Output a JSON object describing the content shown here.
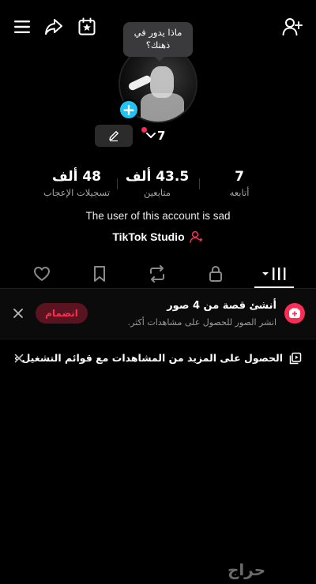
{
  "profile_bubble": "ماذا يدور في ذهنك؟",
  "handle_suffix": "7",
  "stats": {
    "following": {
      "value": "7",
      "label": "أتابعه"
    },
    "followers": {
      "value": "43.5 ألف",
      "label": "متابعين"
    },
    "likes": {
      "value": "48 ألف",
      "label": "تسجيلات الإعجاب"
    }
  },
  "bio": "The user of this account is sad",
  "studio_label": "TikTok Studio",
  "story_card": {
    "title": "أنشئ قصة من 4 صور",
    "subtitle": "انشر الصور للحصول على مشاهدات أكثر.",
    "join_label": "انضمام"
  },
  "playlist_banner": {
    "text": "الحصول على المزيد من المشاهدات مع قوائم التشغيل ›"
  },
  "watermark": "حراج",
  "colors": {
    "accent_red": "#fe2c55",
    "plus_blue": "#20c4f2"
  }
}
